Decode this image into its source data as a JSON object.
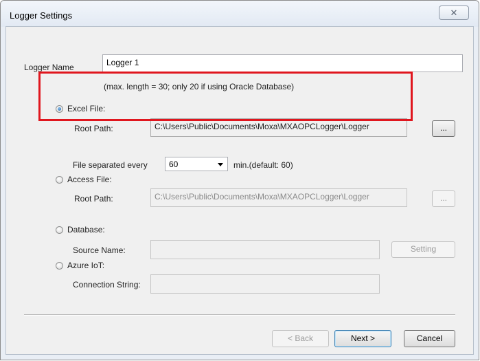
{
  "window": {
    "title": "Logger Settings",
    "close_glyph": "✕"
  },
  "logger_name": {
    "label": "Logger Name",
    "value": "Logger 1",
    "hint": "(max. length = 30; only 20 if using Oracle Database)"
  },
  "excel": {
    "option_label": "Excel File:",
    "selected": true,
    "root_path_label": "Root Path:",
    "root_path_value": "C:\\Users\\Public\\Documents\\Moxa\\MXAOPCLogger\\Logger",
    "browse_label": "...",
    "file_separated_label": "File separated every",
    "interval_value": "60",
    "interval_suffix": "min.(default: 60)"
  },
  "access": {
    "option_label": "Access File:",
    "root_path_label": "Root Path:",
    "root_path_value": "C:\\Users\\Public\\Documents\\Moxa\\MXAOPCLogger\\Logger",
    "browse_label": "..."
  },
  "database": {
    "option_label": "Database:",
    "source_name_label": "Source Name:",
    "source_name_value": "",
    "setting_label": "Setting"
  },
  "azure": {
    "option_label": "Azure IoT:",
    "connection_string_label": "Connection String:",
    "connection_string_value": ""
  },
  "footer": {
    "back_label": "< Back",
    "next_label": "Next >",
    "cancel_label": "Cancel"
  },
  "colors": {
    "highlight": "#e0161e",
    "accent": "#1c5fa8"
  },
  "icons": {
    "close": "close-icon",
    "dropdown": "chevron-down-icon"
  }
}
